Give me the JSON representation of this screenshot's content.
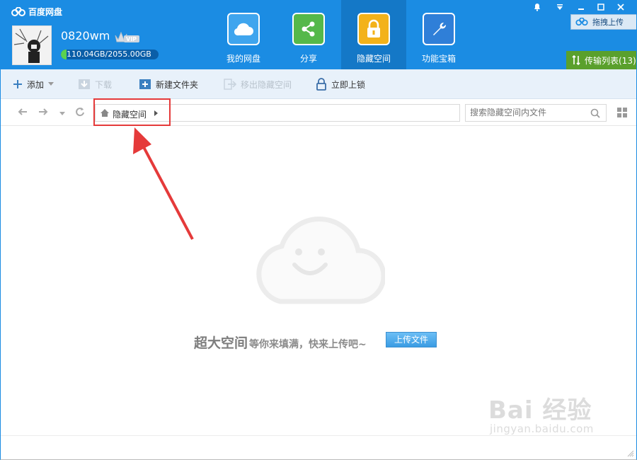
{
  "app": {
    "title": "百度网盘"
  },
  "user": {
    "name": "0820wm",
    "vip_label": "VIP",
    "quota_text": "110.04GB/2055.00GB",
    "quota_fraction": 0.0535
  },
  "nav": [
    {
      "label": "我的网盘",
      "icon": "cloud-icon"
    },
    {
      "label": "分享",
      "icon": "share-icon"
    },
    {
      "label": "隐藏空间",
      "icon": "lock-icon",
      "active": true
    },
    {
      "label": "功能宝箱",
      "icon": "wrench-icon"
    }
  ],
  "window": {
    "upload_drag_label": "拖拽上传",
    "transfer_label": "传输列表(13)"
  },
  "toolbar": {
    "add": "添加",
    "download": "下载",
    "new_folder": "新建文件夹",
    "move_out": "移出隐藏空间",
    "lock_now": "立即上锁"
  },
  "address": {
    "path": "隐藏空间",
    "search_placeholder": "搜索隐藏空间内文件"
  },
  "empty": {
    "big_text": "超大空间",
    "small_text": "等你来填满，快来上传吧~",
    "upload_button": "上传文件"
  },
  "watermark": {
    "main": "Bai 经验",
    "sub": "jingyan.baidu.com"
  },
  "colors": {
    "header_blue": "#1b8ce3",
    "active_tab": "#1478c7",
    "transfer_green": "#5aa02c",
    "highlight_red": "#e53a3a"
  }
}
